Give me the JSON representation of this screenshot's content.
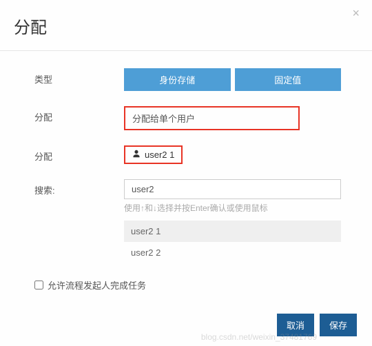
{
  "header": {
    "title": "分配",
    "close": "×"
  },
  "form": {
    "type": {
      "label": "类型",
      "option_identity": "身份存储",
      "option_fixed": "固定值"
    },
    "assign_mode": {
      "label": "分配",
      "value": "分配给单个用户"
    },
    "assign_user": {
      "label": "分配",
      "selected": "user2 1"
    },
    "search": {
      "label": "搜索:",
      "value": "user2",
      "hint": "使用↑和↓选择并按Enter确认或使用鼠标",
      "results": [
        "user2 1",
        "user2 2"
      ]
    },
    "allow_initiator": {
      "label": "允许流程发起人完成任务"
    }
  },
  "footer": {
    "cancel": "取消",
    "save": "保存"
  },
  "watermark": "blog.csdn.net/weixin_37481769"
}
